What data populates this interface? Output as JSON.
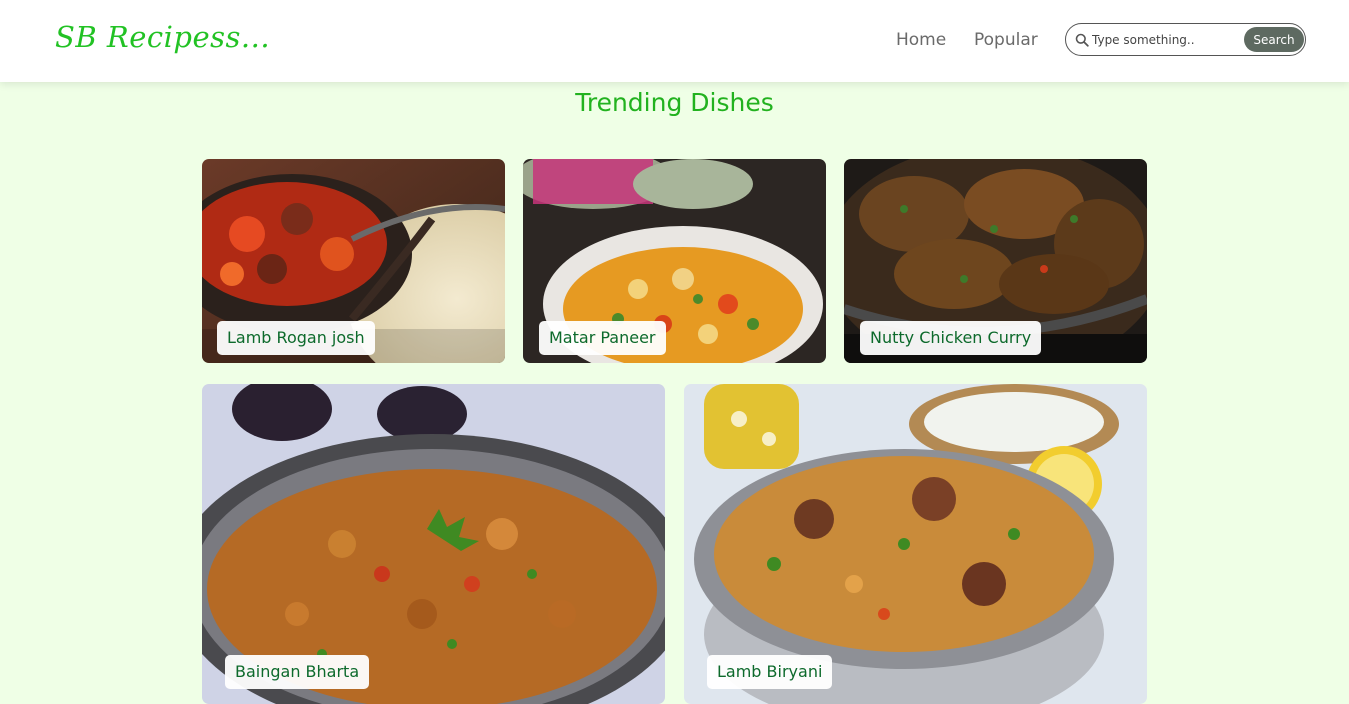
{
  "brand": {
    "logo_text": "SB Recipess...",
    "accent": "#22c224"
  },
  "nav": {
    "links": [
      "Home",
      "Popular"
    ],
    "search": {
      "placeholder": "Type something..",
      "button_label": "Search",
      "icon": "search-icon"
    }
  },
  "main": {
    "title": "Trending Dishes",
    "dishes": [
      {
        "name": "Lamb Rogan josh",
        "image": "curry-dish-photo"
      },
      {
        "name": "Matar Paneer",
        "image": "paneer-dish-photo"
      },
      {
        "name": "Nutty Chicken Curry",
        "image": "chicken-dish-photo"
      },
      {
        "name": "Baingan Bharta",
        "image": "bharta-dish-photo"
      },
      {
        "name": "Lamb Biryani",
        "image": "biryani-dish-photo"
      }
    ]
  },
  "colors": {
    "page_background": "#efffe6",
    "label_text": "#0d6a2c",
    "search_button": "#5e6a61"
  }
}
